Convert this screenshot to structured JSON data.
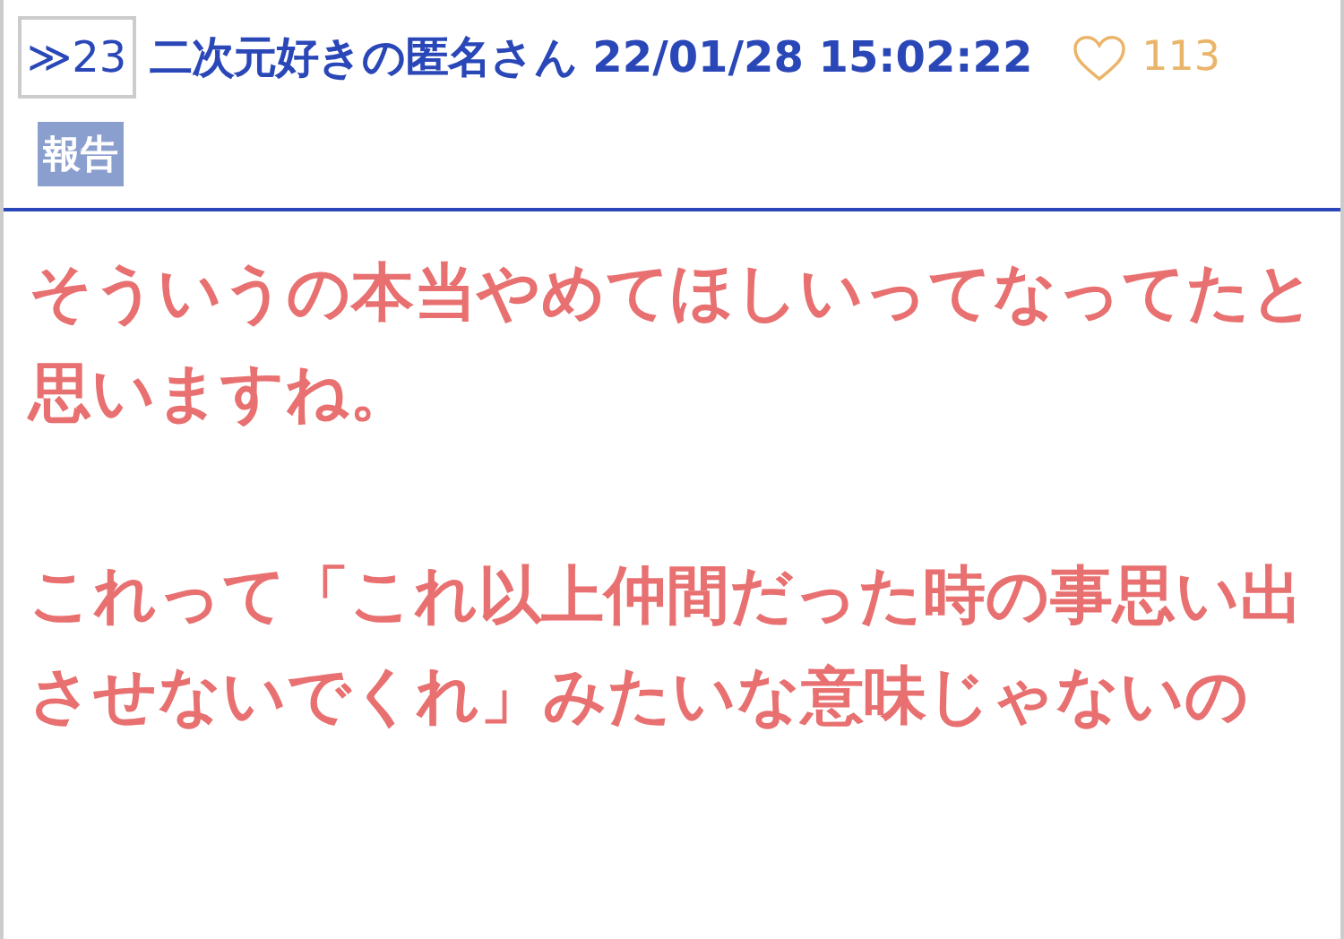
{
  "post": {
    "anchor": "≫23",
    "author": "二次元好きの匿名さん",
    "date": "22/01/28 15:02:22",
    "likes": "113",
    "report_button": "報告",
    "paragraphs": [
      "そういうの本当やめてほしいってなってたと思いますね。",
      "これって「これ以上仲間だった時の事思い出させないでくれ」みたいな意味じゃないの"
    ]
  }
}
